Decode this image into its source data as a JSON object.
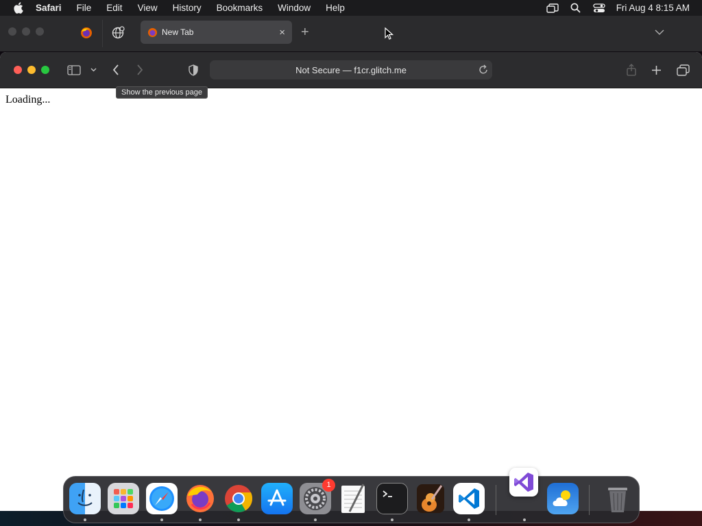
{
  "menubar": {
    "app_name": "Safari",
    "items": [
      "File",
      "Edit",
      "View",
      "History",
      "Bookmarks",
      "Window",
      "Help"
    ],
    "clock": "Fri Aug 4  8:15 AM",
    "icons": [
      "screen-mirroring-icon",
      "spotlight-search-icon",
      "control-center-icon"
    ]
  },
  "background_window": {
    "tab_title": "New Tab",
    "close_glyph": "×",
    "new_tab_glyph": "+"
  },
  "toolbar": {
    "address": "Not Secure — f1cr.glitch.me",
    "tooltip": "Show the previous page"
  },
  "page": {
    "text": "Loading..."
  },
  "dock": {
    "apps": [
      "Finder",
      "Launchpad",
      "Safari",
      "Firefox",
      "Chrome",
      "App Store",
      "System Settings",
      "TextEdit",
      "Terminal",
      "GarageBand",
      "Visual Studio Code",
      "Visual Studio",
      "Weather",
      "Trash"
    ],
    "settings_badge": "1"
  },
  "colors": {
    "close": "#ff5f57",
    "minimize": "#febc2e",
    "zoom": "#28c840",
    "toolbar_bg": "#2c2c2e"
  }
}
